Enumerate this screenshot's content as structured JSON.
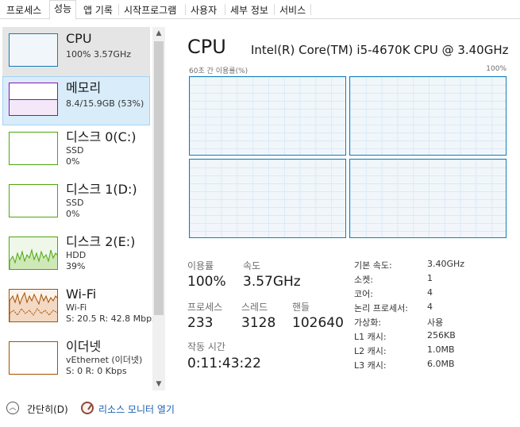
{
  "tabs": [
    {
      "label": "프로세스"
    },
    {
      "label": "성능"
    },
    {
      "label": "앱 기록"
    },
    {
      "label": "시작프로그램"
    },
    {
      "label": "사용자"
    },
    {
      "label": "세부 정보"
    },
    {
      "label": "서비스"
    }
  ],
  "active_tab": "성능",
  "sidebar": {
    "items": [
      {
        "title": "CPU",
        "line1": "100% 3.57GHz",
        "line2": "",
        "color": "#117dbb"
      },
      {
        "title": "메모리",
        "line1": "8.4/15.9GB (53%)",
        "line2": "",
        "color": "#8b12ae"
      },
      {
        "title": "디스크 0(C:)",
        "line1": "SSD",
        "line2": "0%",
        "color": "#4da60c"
      },
      {
        "title": "디스크 1(D:)",
        "line1": "SSD",
        "line2": "0%",
        "color": "#4da60c"
      },
      {
        "title": "디스크 2(E:)",
        "line1": "HDD",
        "line2": "39%",
        "color": "#4da60c"
      },
      {
        "title": "Wi-Fi",
        "line1": "Wi-Fi",
        "line2": "S: 20.5  R: 42.8 Mbps",
        "color": "#a74f01"
      },
      {
        "title": "이더넷",
        "line1": "vEthernet (이더넷)",
        "line2": "S: 0  R: 0 Kbps",
        "color": "#a74f01"
      }
    ]
  },
  "main": {
    "title": "CPU",
    "cpu_model": "Intel(R) Core(TM) i5-4670K CPU @ 3.40GHz",
    "graph_label_left": "60초 간 이용률(%)",
    "graph_label_right": "100%",
    "stats": {
      "usage_label": "이용률",
      "usage_value": "100%",
      "speed_label": "속도",
      "speed_value": "3.57GHz",
      "processes_label": "프로세스",
      "processes_value": "233",
      "threads_label": "스레드",
      "threads_value": "3128",
      "handles_label": "핸들",
      "handles_value": "102640",
      "uptime_label": "작동 시간",
      "uptime_value": "0:11:43:22"
    },
    "info": [
      {
        "key": "기본 속도:",
        "value": "3.40GHz"
      },
      {
        "key": "소켓:",
        "value": "1"
      },
      {
        "key": "코어:",
        "value": "4"
      },
      {
        "key": "논리 프로세서:",
        "value": "4"
      },
      {
        "key": "가상화:",
        "value": "사용"
      },
      {
        "key": "L1 캐시:",
        "value": "256KB"
      },
      {
        "key": "L2 캐시:",
        "value": "1.0MB"
      },
      {
        "key": "L3 캐시:",
        "value": "6.0MB"
      }
    ]
  },
  "footer": {
    "fewer_details": "간단히(D)",
    "resource_monitor": "리소스 모니터 열기"
  }
}
